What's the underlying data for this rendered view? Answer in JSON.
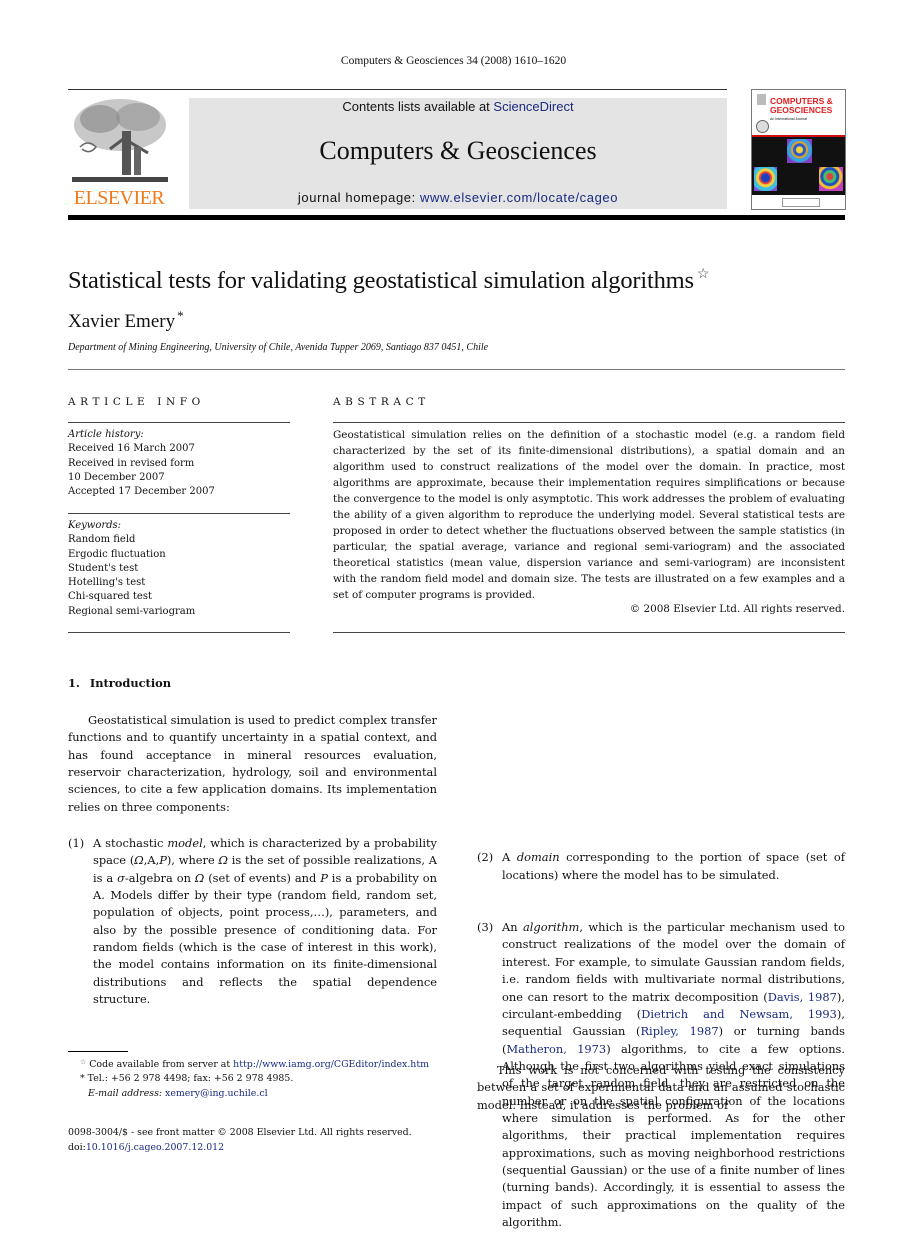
{
  "running_head": "Computers & Geosciences 34 (2008) 1610–1620",
  "masthead": {
    "publisher_logo_text": "ELSEVIER",
    "contents_prefix": "Contents lists available at ",
    "contents_link": "ScienceDirect",
    "journal_title": "Computers & Geosciences",
    "homepage_prefix": "journal homepage: ",
    "homepage_link": "www.elsevier.com/locate/cageo",
    "cover": {
      "title_line1": "COMPUTERS &",
      "title_line2": "GEOSCIENCES",
      "subtitle": "An International Journal"
    },
    "colors": {
      "elsevier_orange": "#f07a1a",
      "banner_gray": "#e4e4e4",
      "link_blue": "#1a2a80",
      "cover_red": "#e02020"
    }
  },
  "article": {
    "title": "Statistical tests for validating geostatistical simulation algorithms",
    "title_mark": "☆",
    "author": "Xavier Emery",
    "author_mark": "*",
    "affiliation": "Department of Mining Engineering, University of Chile, Avenida Tupper 2069, Santiago 837 0451, Chile"
  },
  "article_info": {
    "heading": "ARTICLE INFO",
    "history_label": "Article history:",
    "history": [
      "Received 16 March 2007",
      "Received in revised form",
      "10 December 2007",
      "Accepted 17 December 2007"
    ],
    "keywords_label": "Keywords:",
    "keywords": [
      "Random field",
      "Ergodic fluctuation",
      "Student's test",
      "Hotelling's test",
      "Chi-squared test",
      "Regional semi-variogram"
    ]
  },
  "abstract": {
    "heading": "ABSTRACT",
    "text": "Geostatistical simulation relies on the definition of a stochastic model (e.g. a random field characterized by the set of its finite-dimensional distributions), a spatial domain and an algorithm used to construct realizations of the model over the domain. In practice, most algorithms are approximate, because their implementation requires simplifications or because the convergence to the model is only asymptotic. This work addresses the problem of evaluating the ability of a given algorithm to reproduce the underlying model. Several statistical tests are proposed in order to detect whether the fluctuations observed between the sample statistics (in particular, the spatial average, variance and regional semi-variogram) and the associated theoretical statistics (mean value, dispersion variance and semi-variogram) are inconsistent with the random field model and domain size. The tests are illustrated on a few examples and a set of computer programs is provided.",
    "copyright": "© 2008 Elsevier Ltd. All rights reserved."
  },
  "body": {
    "section": {
      "number": "1.",
      "title": "Introduction"
    },
    "intro_paragraph": "Geostatistical simulation is used to predict complex transfer functions and to quantify uncertainty in a spatial context, and has found acceptance in mineral resources evaluation, reservoir characterization, hydrology, soil and environmental sciences, to cite a few application domains. Its implementation relies on three components:",
    "item1": {
      "label": "(1)",
      "t1": "A stochastic ",
      "em1": "model",
      "t2": ", which is characterized by a probability space (",
      "em2": "Ω",
      "t3": ",A,",
      "em3": "P",
      "t4": "), where ",
      "em4": "Ω",
      "t5": " is the set of possible realizations, A is a ",
      "em5": "σ",
      "t6": "-algebra on ",
      "em6": "Ω",
      "t7": " (set of events) and ",
      "em7": "P",
      "t8": " is a probability on A. Models differ by their type (random field, random set, population of objects, point process,…), parameters, and also by the possible presence of conditioning data. For random fields (which is the case of interest in this work), the model contains information on its finite-dimensional distributions and reflects the spatial dependence structure."
    },
    "item2": {
      "label": "(2)",
      "t1": "A ",
      "em1": "domain",
      "t2": " corresponding to the portion of space (set of locations) where the model has to be simulated."
    },
    "item3": {
      "label": "(3)",
      "t1": "An ",
      "em1": "algorithm",
      "t2": ", which is the particular mechanism used to construct realizations of the model over the domain of interest. For example, to simulate Gaussian random fields, i.e. random fields with multivariate normal distributions, one can resort to the matrix decom­position (",
      "cite1": "Davis, 1987",
      "t3": "), circulant-embedding (",
      "cite2": "Dietrich and Newsam, 1993",
      "t4": "), sequential Gaussian (",
      "cite3": "Ripley, 1987",
      "t5": ") or turning bands (",
      "cite4": "Matheron, 1973",
      "t6": ") algorithms, to cite a few options. Although the first two algo­rithms yield exact simulations of the target random field, they are restricted on the number or on the spatial configuration of the locations where simula­tion is performed. As for the other algorithms, their practical implementation requires approximations, such as moving neighborhood restrictions (sequential Gaussian) or the use of a finite number of lines (turning bands). Accordingly, it is essential to assess the impact of such approximations on the quality of the algorithm."
    },
    "closing_paragraph": "This work is not concerned with testing the consis­tency between a set of experimental data and an assumed stochastic model. Instead, it addresses the problem of"
  },
  "footnotes": {
    "star_mark": "☆",
    "code_text": " Code available from server at ",
    "code_link": "http://www.iamg.org/CGEditor/index.htm",
    "tel_mark": "*",
    "tel_text": " Tel.: +56 2 978 4498; fax: +56 2 978 4985.",
    "email_label": "E-mail address: ",
    "email": "xemery@ing.uchile.cl",
    "front_matter": "0098-3004/$ - see front matter © 2008 Elsevier Ltd. All rights reserved.",
    "doi_prefix": "doi:",
    "doi": "10.1016/j.cageo.2007.12.012"
  }
}
